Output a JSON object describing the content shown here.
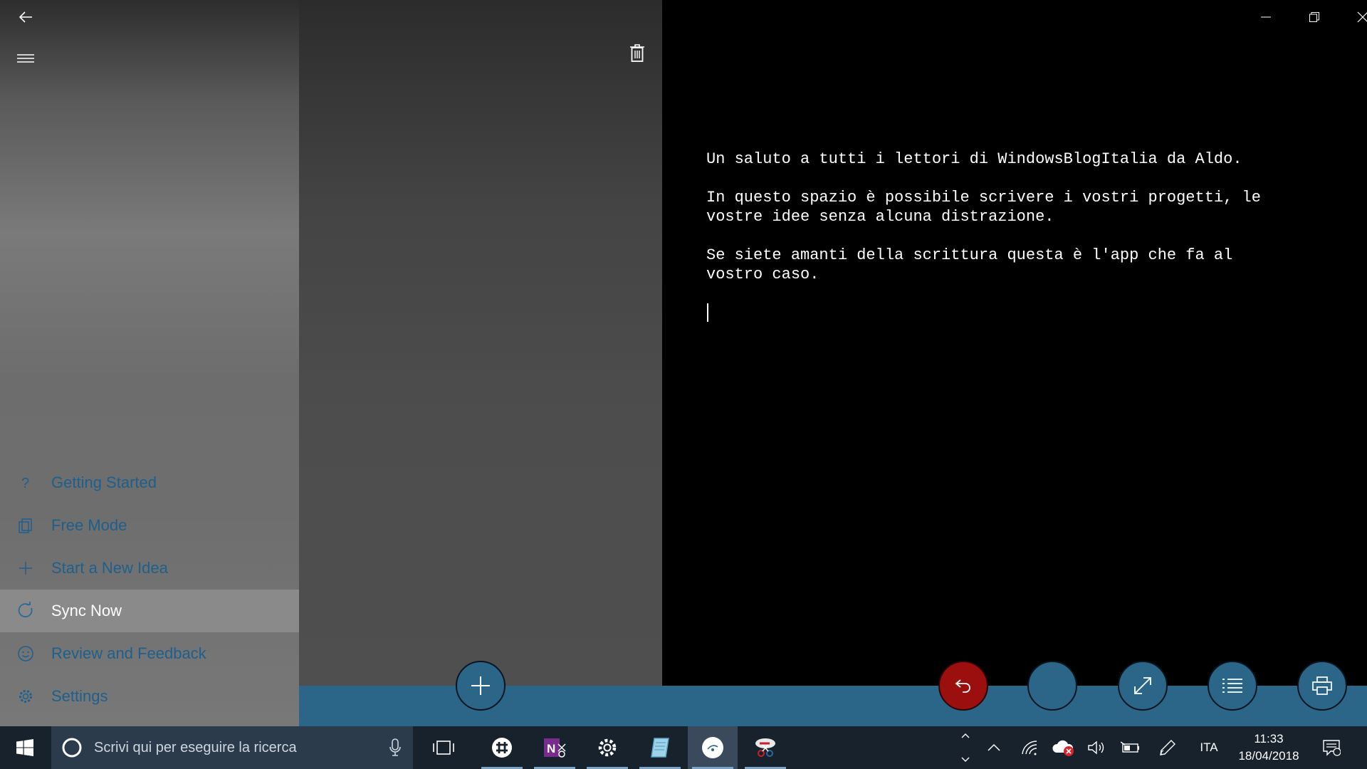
{
  "nav": {
    "items": [
      {
        "label": "Getting Started",
        "icon": "question-icon"
      },
      {
        "label": "Free Mode",
        "icon": "copy-icon"
      },
      {
        "label": "Start a New Idea",
        "icon": "plus-icon"
      },
      {
        "label": "Sync Now",
        "icon": "sync-icon",
        "active": true
      },
      {
        "label": "Review and Feedback",
        "icon": "smiley-icon"
      },
      {
        "label": "Settings",
        "icon": "gear-icon"
      }
    ]
  },
  "editor": {
    "paragraphs": [
      "Un saluto a tutti i lettori di WindowsBlogItalia da Aldo.",
      "In questo spazio è possibile scrivere i vostri progetti, le\nvostre idee senza alcuna distrazione.",
      "Se siete amanti della scrittura questa è l'app che fa al\nvostro caso."
    ]
  },
  "taskbar": {
    "search_placeholder": "Scrivi qui per eseguire la ricerca",
    "language": "ITA",
    "time": "11:33",
    "date": "18/04/2018"
  },
  "colors": {
    "accent": "#2b6688",
    "nav_text": "#1f5f8c",
    "undo": "#9b0f0f",
    "taskbar": "#17222d"
  }
}
